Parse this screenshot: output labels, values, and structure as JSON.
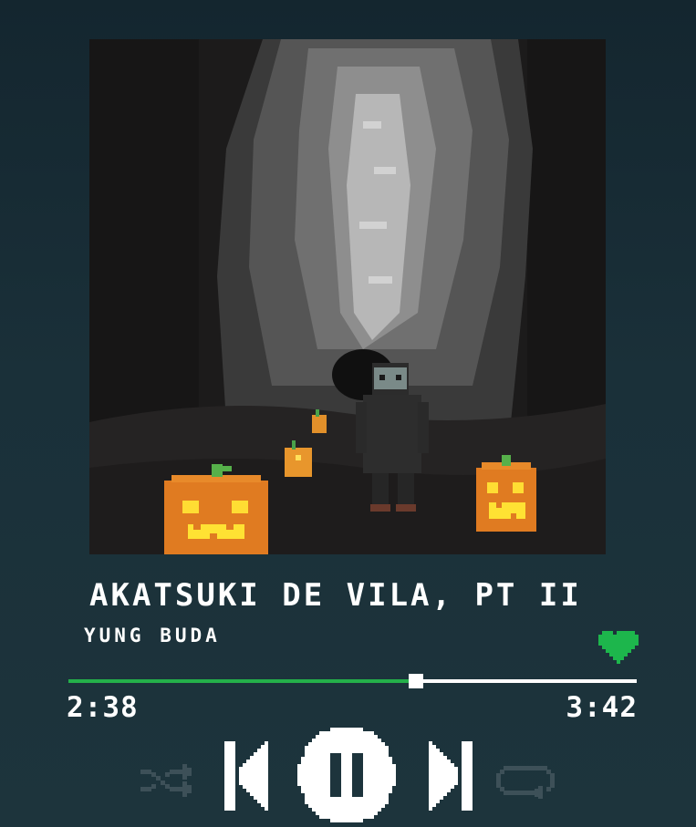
{
  "track": {
    "title": "AKATSUKI DE VILA, PT II",
    "artist": "YUNG BUDA",
    "current_time": "2:38",
    "total_time": "3:42",
    "progress": 0.612,
    "liked": true
  },
  "icons": {
    "like": "heart-icon",
    "shuffle": "shuffle-icon",
    "previous": "skip-previous-icon",
    "play_pause": "pause-icon",
    "next": "skip-next-icon",
    "repeat": "repeat-icon"
  },
  "colors": {
    "accent": "#24b04a",
    "heart": "#1db64c",
    "text": "#ffffff",
    "inactive_control": "#3d5058"
  }
}
